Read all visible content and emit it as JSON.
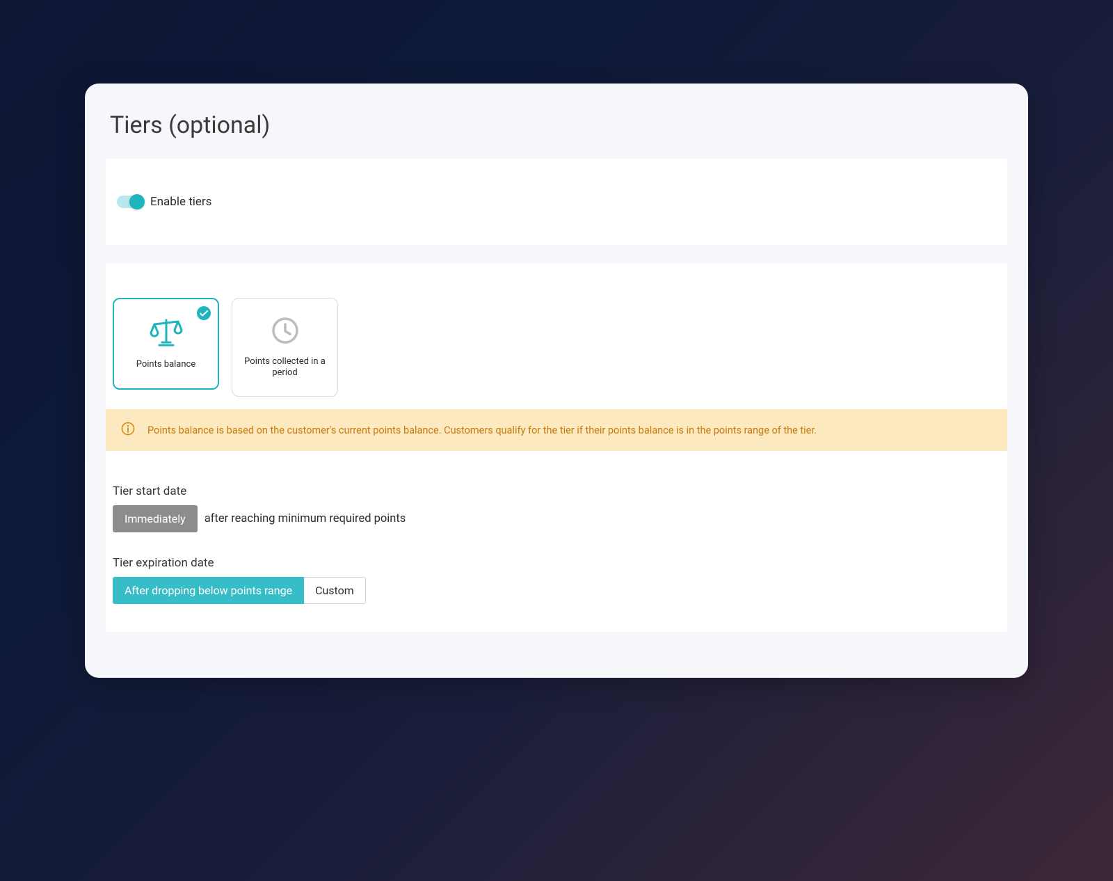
{
  "page": {
    "title": "Tiers (optional)"
  },
  "enable": {
    "label": "Enable tiers",
    "on": true
  },
  "options": {
    "points_balance": "Points balance",
    "points_collected": "Points collected in a period"
  },
  "info": {
    "message": "Points balance is based on the customer's current points balance. Customers qualify for the tier if their points balance is in the points range of the tier."
  },
  "start_date": {
    "label": "Tier start date",
    "button": "Immediately",
    "suffix": "after reaching minimum required points"
  },
  "expiration": {
    "label": "Tier expiration date",
    "option_a": "After dropping below points range",
    "option_b": "Custom"
  }
}
